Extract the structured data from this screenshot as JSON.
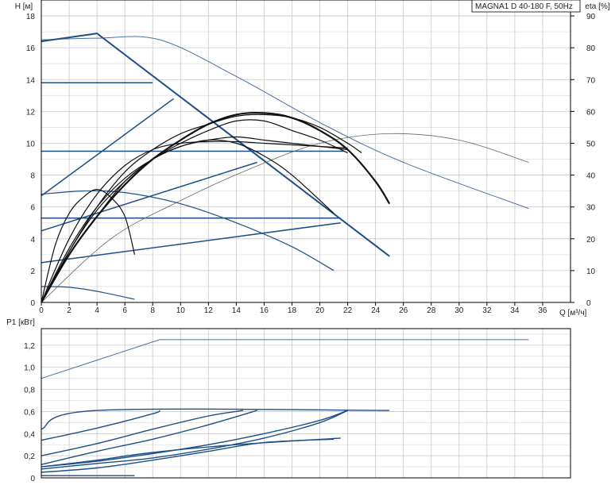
{
  "chart_data": [
    {
      "type": "line",
      "title": "MAGNA1 D 40-180 F, 50Hz",
      "xlabel": "Q [м³/ч]",
      "ylabel": "H [м]",
      "y2label": "eta [%]",
      "x_ticks": [
        "0",
        "2",
        "4",
        "6",
        "8",
        "10",
        "12",
        "14",
        "16",
        "18",
        "20",
        "22",
        "24",
        "26",
        "28",
        "30",
        "32",
        "34",
        "36"
      ],
      "y_ticks": [
        "0",
        "2",
        "4",
        "6",
        "8",
        "10",
        "12",
        "14",
        "16",
        "18"
      ],
      "y2_ticks": [
        "0",
        "10",
        "20",
        "30",
        "40",
        "50",
        "60",
        "70",
        "80",
        "90"
      ],
      "xlim": [
        0,
        38
      ],
      "ylim": [
        0,
        19
      ],
      "y2lim": [
        0,
        95
      ],
      "grid": true,
      "series": [
        {
          "group": "head-max-single",
          "axis": "y",
          "x": [
            0,
            4,
            8.5,
            14,
            20,
            26,
            35
          ],
          "values": [
            16.5,
            16.6,
            16.5,
            14.2,
            11.3,
            8.8,
            5.9
          ]
        },
        {
          "group": "head-single-speed",
          "axis": "y",
          "x": [
            0,
            2,
            4,
            6.7
          ],
          "values": [
            1.0,
            0.95,
            0.7,
            0.2
          ]
        },
        {
          "group": "head-single-speed",
          "axis": "y",
          "x": [
            0,
            3,
            6,
            10,
            14,
            18,
            21
          ],
          "values": [
            6.8,
            7.0,
            6.9,
            6.2,
            5.0,
            3.5,
            2.0
          ]
        },
        {
          "group": "control-max-pp",
          "axis": "y",
          "x": [
            0,
            4,
            25
          ],
          "values": [
            16.4,
            16.9,
            2.9
          ]
        },
        {
          "group": "control-pp",
          "axis": "y",
          "x": [
            0,
            9.5
          ],
          "values": [
            6.7,
            12.8
          ]
        },
        {
          "group": "control-pp",
          "axis": "y",
          "x": [
            0,
            15.5
          ],
          "values": [
            4.5,
            8.8
          ]
        },
        {
          "group": "control-pp",
          "axis": "y",
          "x": [
            0,
            21.5
          ],
          "values": [
            2.5,
            5.0
          ]
        },
        {
          "group": "control-cp",
          "axis": "y",
          "x": [
            0,
            8
          ],
          "values": [
            13.8,
            13.8
          ]
        },
        {
          "group": "control-cp",
          "axis": "y",
          "x": [
            0,
            21.7
          ],
          "values": [
            9.5,
            9.5
          ]
        },
        {
          "group": "control-cp",
          "axis": "y",
          "x": [
            0,
            21.5
          ],
          "values": [
            5.3,
            5.3
          ]
        },
        {
          "group": "efficiency-max",
          "axis": "y2",
          "x": [
            0,
            5,
            10,
            15,
            20,
            25,
            30,
            35
          ],
          "values": [
            0,
            20,
            32,
            42,
            50,
            53,
            51,
            44
          ]
        },
        {
          "group": "efficiency",
          "axis": "y2",
          "x": [
            0,
            1,
            2,
            3,
            4,
            5,
            6,
            6.7
          ],
          "values": [
            0,
            18,
            28,
            33,
            35.5,
            33,
            27,
            15
          ]
        },
        {
          "group": "efficiency",
          "axis": "y2",
          "x": [
            0,
            2,
            4,
            6,
            8,
            10,
            12,
            14,
            16,
            18,
            21
          ],
          "values": [
            0,
            17,
            30,
            39,
            45,
            49,
            51,
            50,
            46,
            40,
            28
          ]
        },
        {
          "group": "efficiency",
          "axis": "y2",
          "x": [
            0,
            2,
            4,
            6,
            8,
            10,
            12,
            14,
            16,
            18,
            20,
            22
          ],
          "values": [
            0,
            16,
            29,
            38,
            45,
            49,
            51,
            52,
            51,
            50,
            49,
            48
          ]
        },
        {
          "group": "efficiency",
          "axis": "y2",
          "x": [
            0,
            2,
            4,
            6,
            8,
            10,
            12,
            14,
            16,
            18,
            20,
            22
          ],
          "values": [
            0,
            20,
            34,
            43,
            48,
            50,
            50.5,
            50.5,
            50,
            49.5,
            49,
            48.5
          ]
        },
        {
          "group": "efficiency",
          "axis": "y2",
          "x": [
            0,
            2,
            4,
            6,
            8,
            10,
            12,
            14,
            16,
            18,
            20,
            22
          ],
          "values": [
            0,
            15,
            27,
            38,
            45,
            50,
            54,
            57,
            57,
            54,
            51,
            47
          ]
        },
        {
          "group": "efficiency",
          "axis": "y2",
          "x": [
            0,
            2,
            4,
            6,
            8,
            10,
            12,
            14,
            16,
            18,
            20,
            22,
            23
          ],
          "values": [
            0,
            16,
            30,
            41,
            48,
            53,
            56,
            58.5,
            59,
            58,
            55,
            50,
            47
          ]
        },
        {
          "group": "efficiency-bold",
          "axis": "y2",
          "x": [
            0,
            2,
            4,
            6,
            8,
            10,
            12,
            14,
            16,
            18,
            20,
            22,
            24,
            25
          ],
          "values": [
            0,
            15,
            27,
            37,
            45,
            51,
            56,
            59,
            59.5,
            58,
            54,
            48,
            38,
            31
          ]
        }
      ]
    },
    {
      "type": "line",
      "ylabel": "P1 [кВт]",
      "y_ticks": [
        "0",
        "0,2",
        "0,4",
        "0,6",
        "0,8",
        "1,0",
        "1,2"
      ],
      "xlim": [
        0,
        38
      ],
      "ylim": [
        0,
        1.35
      ],
      "grid": true,
      "series": [
        {
          "group": "power-max",
          "x": [
            0,
            8.5,
            35
          ],
          "values": [
            0.9,
            1.25,
            1.25
          ]
        },
        {
          "group": "power",
          "x": [
            0,
            4,
            25
          ],
          "values": [
            0.44,
            0.61,
            0.61
          ]
        },
        {
          "group": "power",
          "x": [
            0,
            4,
            8,
            8.5
          ],
          "values": [
            0.34,
            0.45,
            0.58,
            0.61
          ]
        },
        {
          "group": "power",
          "x": [
            0,
            4,
            8,
            12,
            14.5
          ],
          "values": [
            0.2,
            0.31,
            0.44,
            0.56,
            0.61
          ]
        },
        {
          "group": "power",
          "x": [
            0,
            4,
            8,
            12,
            15.5
          ],
          "values": [
            0.12,
            0.24,
            0.35,
            0.48,
            0.61
          ]
        },
        {
          "group": "power",
          "x": [
            0,
            4,
            8,
            12,
            16,
            20,
            22
          ],
          "values": [
            0.1,
            0.15,
            0.22,
            0.3,
            0.4,
            0.52,
            0.61
          ]
        },
        {
          "group": "power",
          "x": [
            0,
            4,
            8,
            12,
            16,
            20,
            22
          ],
          "values": [
            0.08,
            0.13,
            0.18,
            0.26,
            0.36,
            0.5,
            0.61
          ]
        },
        {
          "group": "power",
          "x": [
            0,
            4,
            8,
            12,
            16,
            21
          ],
          "values": [
            0.05,
            0.09,
            0.16,
            0.24,
            0.32,
            0.35
          ]
        },
        {
          "group": "power",
          "x": [
            0,
            4,
            8,
            14,
            21.5
          ],
          "values": [
            0.1,
            0.16,
            0.23,
            0.3,
            0.36
          ]
        },
        {
          "group": "power",
          "x": [
            0,
            6.7
          ],
          "values": [
            0.02,
            0.02
          ]
        }
      ]
    }
  ],
  "colors": {
    "head": "#1d4f86",
    "head_thin": "#4a6fa0",
    "efficiency": "#111111",
    "efficiency_thin": "#666666",
    "grid": "#c8c8c8"
  }
}
